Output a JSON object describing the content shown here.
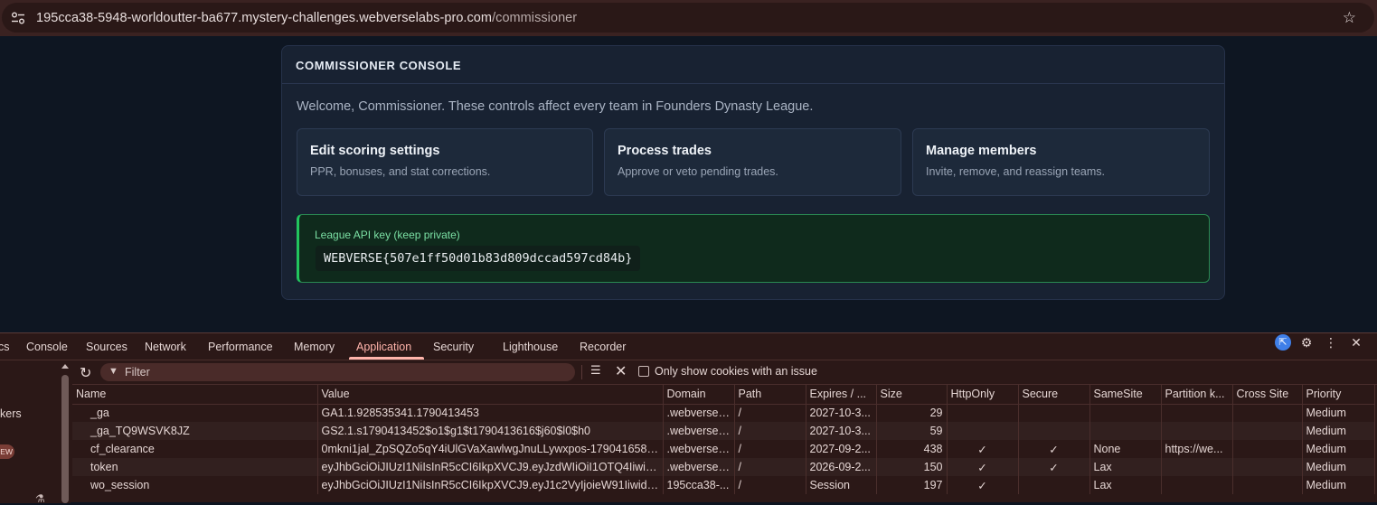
{
  "browser": {
    "url_host": "195cca38-5948-worldoutter-ba677.mystery-challenges.webverselabs-pro.com",
    "url_path": "/commissioner",
    "site_icon": "tune-icon",
    "bookmark_icon": "star-outline-icon"
  },
  "console": {
    "title": "COMMISSIONER CONSOLE",
    "welcome": "Welcome, Commissioner. These controls affect every team in Founders Dynasty League.",
    "tiles": [
      {
        "title": "Edit scoring settings",
        "desc": "PPR, bonuses, and stat corrections."
      },
      {
        "title": "Process trades",
        "desc": "Approve or veto pending trades."
      },
      {
        "title": "Manage members",
        "desc": "Invite, remove, and reassign teams."
      }
    ],
    "api_key_label": "League API key (keep private)",
    "api_key_value": "WEBVERSE{507e1ff50d01b83d809dccad597cd84b}"
  },
  "devtools": {
    "tabs": [
      "cs",
      "Console",
      "Sources",
      "Network",
      "Performance",
      "Memory",
      "Application",
      "Security",
      "Lighthouse",
      "Recorder"
    ],
    "active_tab": "Application",
    "left_pane_text": "kers",
    "left_pane_badge": "EW",
    "filter_placeholder": "Filter",
    "only_issue_label": "Only show cookies with an issue",
    "columns": [
      "Name",
      "Value",
      "Domain",
      "Path",
      "Expires / ...",
      "Size",
      "HttpOnly",
      "Secure",
      "SameSite",
      "Partition k...",
      "Cross Site",
      "Priority"
    ],
    "rows": [
      {
        "name": "_ga",
        "value": "GA1.1.928535341.1790413453",
        "domain": ".webversel...",
        "path": "/",
        "expires": "2027-10-3...",
        "size": "29",
        "httponly": "",
        "secure": "",
        "samesite": "",
        "partition": "",
        "cross_site": "",
        "priority": "Medium"
      },
      {
        "name": "_ga_TQ9WSVK8JZ",
        "value": "GS2.1.s1790413452$o1$g1$t1790413616$j60$l0$h0",
        "domain": ".webversel...",
        "path": "/",
        "expires": "2027-10-3...",
        "size": "59",
        "httponly": "",
        "secure": "",
        "samesite": "",
        "partition": "",
        "cross_site": "",
        "priority": "Medium"
      },
      {
        "name": "cf_clearance",
        "value": "0mkni1jal_ZpSQZo5qY4iUlGVaXawlwgJnuLLywxpos-1790416580-...",
        "domain": ".webversel...",
        "path": "/",
        "expires": "2027-09-2...",
        "size": "438",
        "httponly": "✓",
        "secure": "✓",
        "samesite": "None",
        "partition": "https://we...",
        "cross_site": "",
        "priority": "Medium"
      },
      {
        "name": "token",
        "value": "eyJhbGciOiJIUzI1NiIsInR5cCI6IkpXVCJ9.eyJzdWIiOiI1OTQ4IiwiZXh...",
        "domain": ".webversel...",
        "path": "/",
        "expires": "2026-09-2...",
        "size": "150",
        "httponly": "✓",
        "secure": "✓",
        "samesite": "Lax",
        "partition": "",
        "cross_site": "",
        "priority": "Medium"
      },
      {
        "name": "wo_session",
        "value": "eyJhbGciOiJIUzI1NiIsInR5cCI6IkpXVCJ9.eyJ1c2VyIjoieW91IiwidGV...",
        "domain": "195cca38-...",
        "path": "/",
        "expires": "Session",
        "size": "197",
        "httponly": "✓",
        "secure": "",
        "samesite": "Lax",
        "partition": "",
        "cross_site": "",
        "priority": "Medium"
      }
    ]
  }
}
